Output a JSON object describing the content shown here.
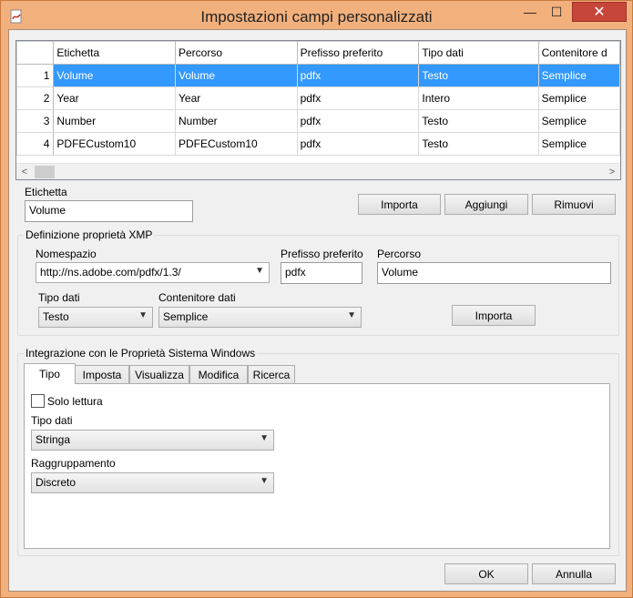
{
  "window": {
    "title": "Impostazioni campi personalizzati",
    "close_glyph": "✕",
    "min_glyph": "—",
    "max_glyph": "☐"
  },
  "grid": {
    "columns": [
      "Etichetta",
      "Percorso",
      "Prefisso preferito",
      "Tipo dati",
      "Contenitore d"
    ],
    "rows": [
      {
        "num": "1",
        "cells": [
          "Volume",
          "Volume",
          "pdfx",
          "Testo",
          "Semplice"
        ]
      },
      {
        "num": "2",
        "cells": [
          "Year",
          "Year",
          "pdfx",
          "Intero",
          "Semplice"
        ]
      },
      {
        "num": "3",
        "cells": [
          "Number",
          "Number",
          "pdfx",
          "Testo",
          "Semplice"
        ]
      },
      {
        "num": "4",
        "cells": [
          "PDFECustom10",
          "PDFECustom10",
          "pdfx",
          "Testo",
          "Semplice"
        ]
      }
    ],
    "scroll_left": "<",
    "scroll_right": ">"
  },
  "label_field": {
    "label": "Etichetta",
    "value": "Volume"
  },
  "buttons": {
    "import": "Importa",
    "add": "Aggiungi",
    "remove": "Rimuovi"
  },
  "xmp": {
    "title": "Definizione proprietà XMP",
    "namespace_label": "Nomespazio",
    "namespace_value": "http://ns.adobe.com/pdfx/1.3/",
    "prefix_label": "Prefisso preferito",
    "prefix_value": "pdfx",
    "path_label": "Percorso",
    "path_value": "Volume",
    "datatype_label": "Tipo dati",
    "datatype_value": "Testo",
    "container_label": "Contenitore dati",
    "container_value": "Semplice",
    "import_label": "Importa"
  },
  "windows_integration": {
    "title": "Integrazione con le Proprietà Sistema Windows",
    "tabs": [
      "Tipo",
      "Imposta",
      "Visualizza",
      "Modifica",
      "Ricerca"
    ],
    "readonly_label": "Solo lettura",
    "datatype_label": "Tipo dati",
    "datatype_value": "Stringa",
    "grouping_label": "Raggruppamento",
    "grouping_value": "Discreto"
  },
  "footer": {
    "ok": "OK",
    "cancel": "Annulla"
  }
}
